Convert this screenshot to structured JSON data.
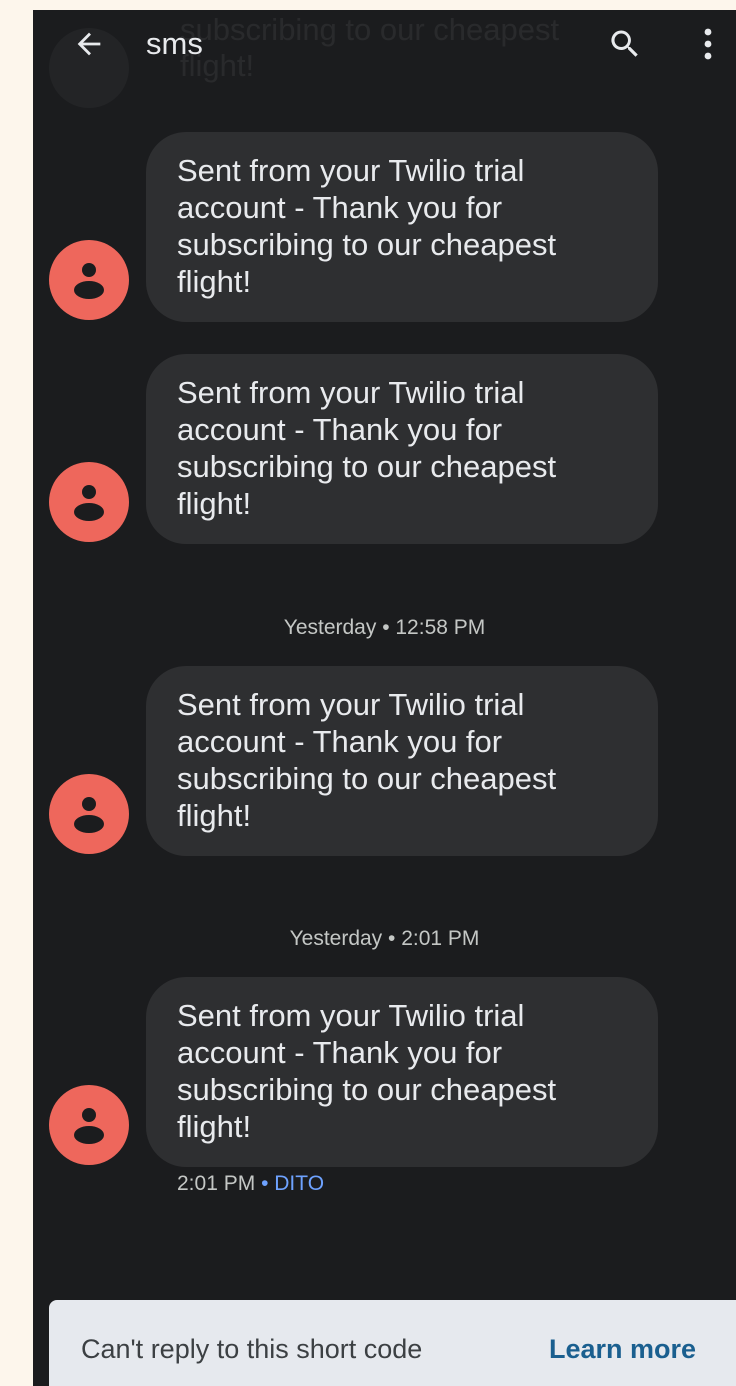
{
  "appbar": {
    "title": "sms",
    "icons": [
      "back-arrow-icon",
      "search-icon",
      "more-vert-icon"
    ]
  },
  "scrolled_behind": "subscribing to our cheapest flight!",
  "colors": {
    "avatar": "#ee675c",
    "bubble": "#2e2f31",
    "background": "#1b1c1e",
    "link": "#6ea2ff",
    "learn_more": "#1a5f8f"
  },
  "messages": [
    {
      "text": "Sent from your Twilio trial account - Thank you for subscribing to our cheapest flight!"
    },
    {
      "text": "Sent from your Twilio trial account - Thank you for subscribing to our cheapest flight!"
    },
    {
      "text": "Sent from your Twilio trial account - Thank you for subscribing to our cheapest flight!"
    },
    {
      "text": "Sent from your Twilio trial account - Thank you for subscribing to our cheapest flight!"
    }
  ],
  "timestamps": [
    "Yesterday • 12:58 PM",
    "Yesterday • 2:01 PM"
  ],
  "last_meta": {
    "time": "2:01 PM",
    "separator": "•",
    "carrier": "DITO"
  },
  "footer": {
    "notice": "Can't reply to this short code",
    "link": "Learn more"
  }
}
